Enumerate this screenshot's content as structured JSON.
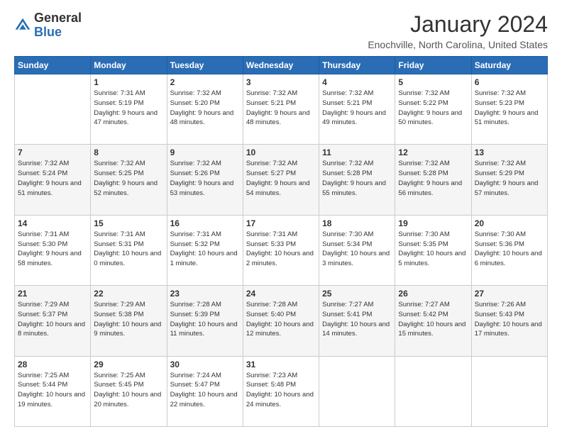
{
  "header": {
    "logo_general": "General",
    "logo_blue": "Blue",
    "main_title": "January 2024",
    "subtitle": "Enochville, North Carolina, United States"
  },
  "calendar": {
    "days_of_week": [
      "Sunday",
      "Monday",
      "Tuesday",
      "Wednesday",
      "Thursday",
      "Friday",
      "Saturday"
    ],
    "rows": [
      [
        {
          "num": "",
          "sunrise": "",
          "sunset": "",
          "daylight": ""
        },
        {
          "num": "1",
          "sunrise": "Sunrise: 7:31 AM",
          "sunset": "Sunset: 5:19 PM",
          "daylight": "Daylight: 9 hours and 47 minutes."
        },
        {
          "num": "2",
          "sunrise": "Sunrise: 7:32 AM",
          "sunset": "Sunset: 5:20 PM",
          "daylight": "Daylight: 9 hours and 48 minutes."
        },
        {
          "num": "3",
          "sunrise": "Sunrise: 7:32 AM",
          "sunset": "Sunset: 5:21 PM",
          "daylight": "Daylight: 9 hours and 48 minutes."
        },
        {
          "num": "4",
          "sunrise": "Sunrise: 7:32 AM",
          "sunset": "Sunset: 5:21 PM",
          "daylight": "Daylight: 9 hours and 49 minutes."
        },
        {
          "num": "5",
          "sunrise": "Sunrise: 7:32 AM",
          "sunset": "Sunset: 5:22 PM",
          "daylight": "Daylight: 9 hours and 50 minutes."
        },
        {
          "num": "6",
          "sunrise": "Sunrise: 7:32 AM",
          "sunset": "Sunset: 5:23 PM",
          "daylight": "Daylight: 9 hours and 51 minutes."
        }
      ],
      [
        {
          "num": "7",
          "sunrise": "Sunrise: 7:32 AM",
          "sunset": "Sunset: 5:24 PM",
          "daylight": "Daylight: 9 hours and 51 minutes."
        },
        {
          "num": "8",
          "sunrise": "Sunrise: 7:32 AM",
          "sunset": "Sunset: 5:25 PM",
          "daylight": "Daylight: 9 hours and 52 minutes."
        },
        {
          "num": "9",
          "sunrise": "Sunrise: 7:32 AM",
          "sunset": "Sunset: 5:26 PM",
          "daylight": "Daylight: 9 hours and 53 minutes."
        },
        {
          "num": "10",
          "sunrise": "Sunrise: 7:32 AM",
          "sunset": "Sunset: 5:27 PM",
          "daylight": "Daylight: 9 hours and 54 minutes."
        },
        {
          "num": "11",
          "sunrise": "Sunrise: 7:32 AM",
          "sunset": "Sunset: 5:28 PM",
          "daylight": "Daylight: 9 hours and 55 minutes."
        },
        {
          "num": "12",
          "sunrise": "Sunrise: 7:32 AM",
          "sunset": "Sunset: 5:28 PM",
          "daylight": "Daylight: 9 hours and 56 minutes."
        },
        {
          "num": "13",
          "sunrise": "Sunrise: 7:32 AM",
          "sunset": "Sunset: 5:29 PM",
          "daylight": "Daylight: 9 hours and 57 minutes."
        }
      ],
      [
        {
          "num": "14",
          "sunrise": "Sunrise: 7:31 AM",
          "sunset": "Sunset: 5:30 PM",
          "daylight": "Daylight: 9 hours and 58 minutes."
        },
        {
          "num": "15",
          "sunrise": "Sunrise: 7:31 AM",
          "sunset": "Sunset: 5:31 PM",
          "daylight": "Daylight: 10 hours and 0 minutes."
        },
        {
          "num": "16",
          "sunrise": "Sunrise: 7:31 AM",
          "sunset": "Sunset: 5:32 PM",
          "daylight": "Daylight: 10 hours and 1 minute."
        },
        {
          "num": "17",
          "sunrise": "Sunrise: 7:31 AM",
          "sunset": "Sunset: 5:33 PM",
          "daylight": "Daylight: 10 hours and 2 minutes."
        },
        {
          "num": "18",
          "sunrise": "Sunrise: 7:30 AM",
          "sunset": "Sunset: 5:34 PM",
          "daylight": "Daylight: 10 hours and 3 minutes."
        },
        {
          "num": "19",
          "sunrise": "Sunrise: 7:30 AM",
          "sunset": "Sunset: 5:35 PM",
          "daylight": "Daylight: 10 hours and 5 minutes."
        },
        {
          "num": "20",
          "sunrise": "Sunrise: 7:30 AM",
          "sunset": "Sunset: 5:36 PM",
          "daylight": "Daylight: 10 hours and 6 minutes."
        }
      ],
      [
        {
          "num": "21",
          "sunrise": "Sunrise: 7:29 AM",
          "sunset": "Sunset: 5:37 PM",
          "daylight": "Daylight: 10 hours and 8 minutes."
        },
        {
          "num": "22",
          "sunrise": "Sunrise: 7:29 AM",
          "sunset": "Sunset: 5:38 PM",
          "daylight": "Daylight: 10 hours and 9 minutes."
        },
        {
          "num": "23",
          "sunrise": "Sunrise: 7:28 AM",
          "sunset": "Sunset: 5:39 PM",
          "daylight": "Daylight: 10 hours and 11 minutes."
        },
        {
          "num": "24",
          "sunrise": "Sunrise: 7:28 AM",
          "sunset": "Sunset: 5:40 PM",
          "daylight": "Daylight: 10 hours and 12 minutes."
        },
        {
          "num": "25",
          "sunrise": "Sunrise: 7:27 AM",
          "sunset": "Sunset: 5:41 PM",
          "daylight": "Daylight: 10 hours and 14 minutes."
        },
        {
          "num": "26",
          "sunrise": "Sunrise: 7:27 AM",
          "sunset": "Sunset: 5:42 PM",
          "daylight": "Daylight: 10 hours and 15 minutes."
        },
        {
          "num": "27",
          "sunrise": "Sunrise: 7:26 AM",
          "sunset": "Sunset: 5:43 PM",
          "daylight": "Daylight: 10 hours and 17 minutes."
        }
      ],
      [
        {
          "num": "28",
          "sunrise": "Sunrise: 7:25 AM",
          "sunset": "Sunset: 5:44 PM",
          "daylight": "Daylight: 10 hours and 19 minutes."
        },
        {
          "num": "29",
          "sunrise": "Sunrise: 7:25 AM",
          "sunset": "Sunset: 5:45 PM",
          "daylight": "Daylight: 10 hours and 20 minutes."
        },
        {
          "num": "30",
          "sunrise": "Sunrise: 7:24 AM",
          "sunset": "Sunset: 5:47 PM",
          "daylight": "Daylight: 10 hours and 22 minutes."
        },
        {
          "num": "31",
          "sunrise": "Sunrise: 7:23 AM",
          "sunset": "Sunset: 5:48 PM",
          "daylight": "Daylight: 10 hours and 24 minutes."
        },
        {
          "num": "",
          "sunrise": "",
          "sunset": "",
          "daylight": ""
        },
        {
          "num": "",
          "sunrise": "",
          "sunset": "",
          "daylight": ""
        },
        {
          "num": "",
          "sunrise": "",
          "sunset": "",
          "daylight": ""
        }
      ]
    ]
  }
}
